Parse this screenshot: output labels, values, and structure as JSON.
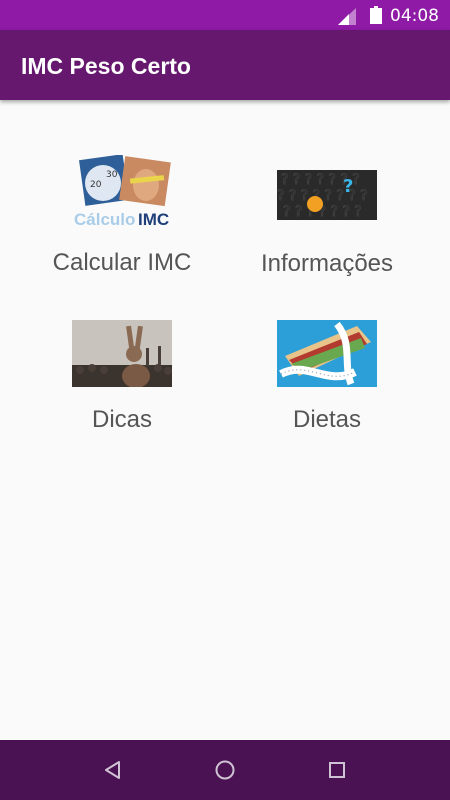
{
  "status_bar": {
    "time": "04:08"
  },
  "app_bar": {
    "title": "IMC Peso Certo"
  },
  "grid": [
    {
      "label": "Calcular IMC",
      "thumb_icon": "calculo-imc-image",
      "thumb_text_a": "Cálculo",
      "thumb_text_b": "IMC"
    },
    {
      "label": "Informações",
      "thumb_icon": "question-marks-image"
    },
    {
      "label": "Dicas",
      "thumb_icon": "yoga-class-image"
    },
    {
      "label": "Dietas",
      "thumb_icon": "sandwich-tape-image"
    }
  ],
  "nav_bar": {
    "buttons": [
      "back-icon",
      "home-icon",
      "recents-icon"
    ]
  },
  "colors": {
    "status_bar": "#8e1aa6",
    "app_bar": "#65186e",
    "nav_bar": "#4a1252",
    "background": "#fafafa"
  }
}
